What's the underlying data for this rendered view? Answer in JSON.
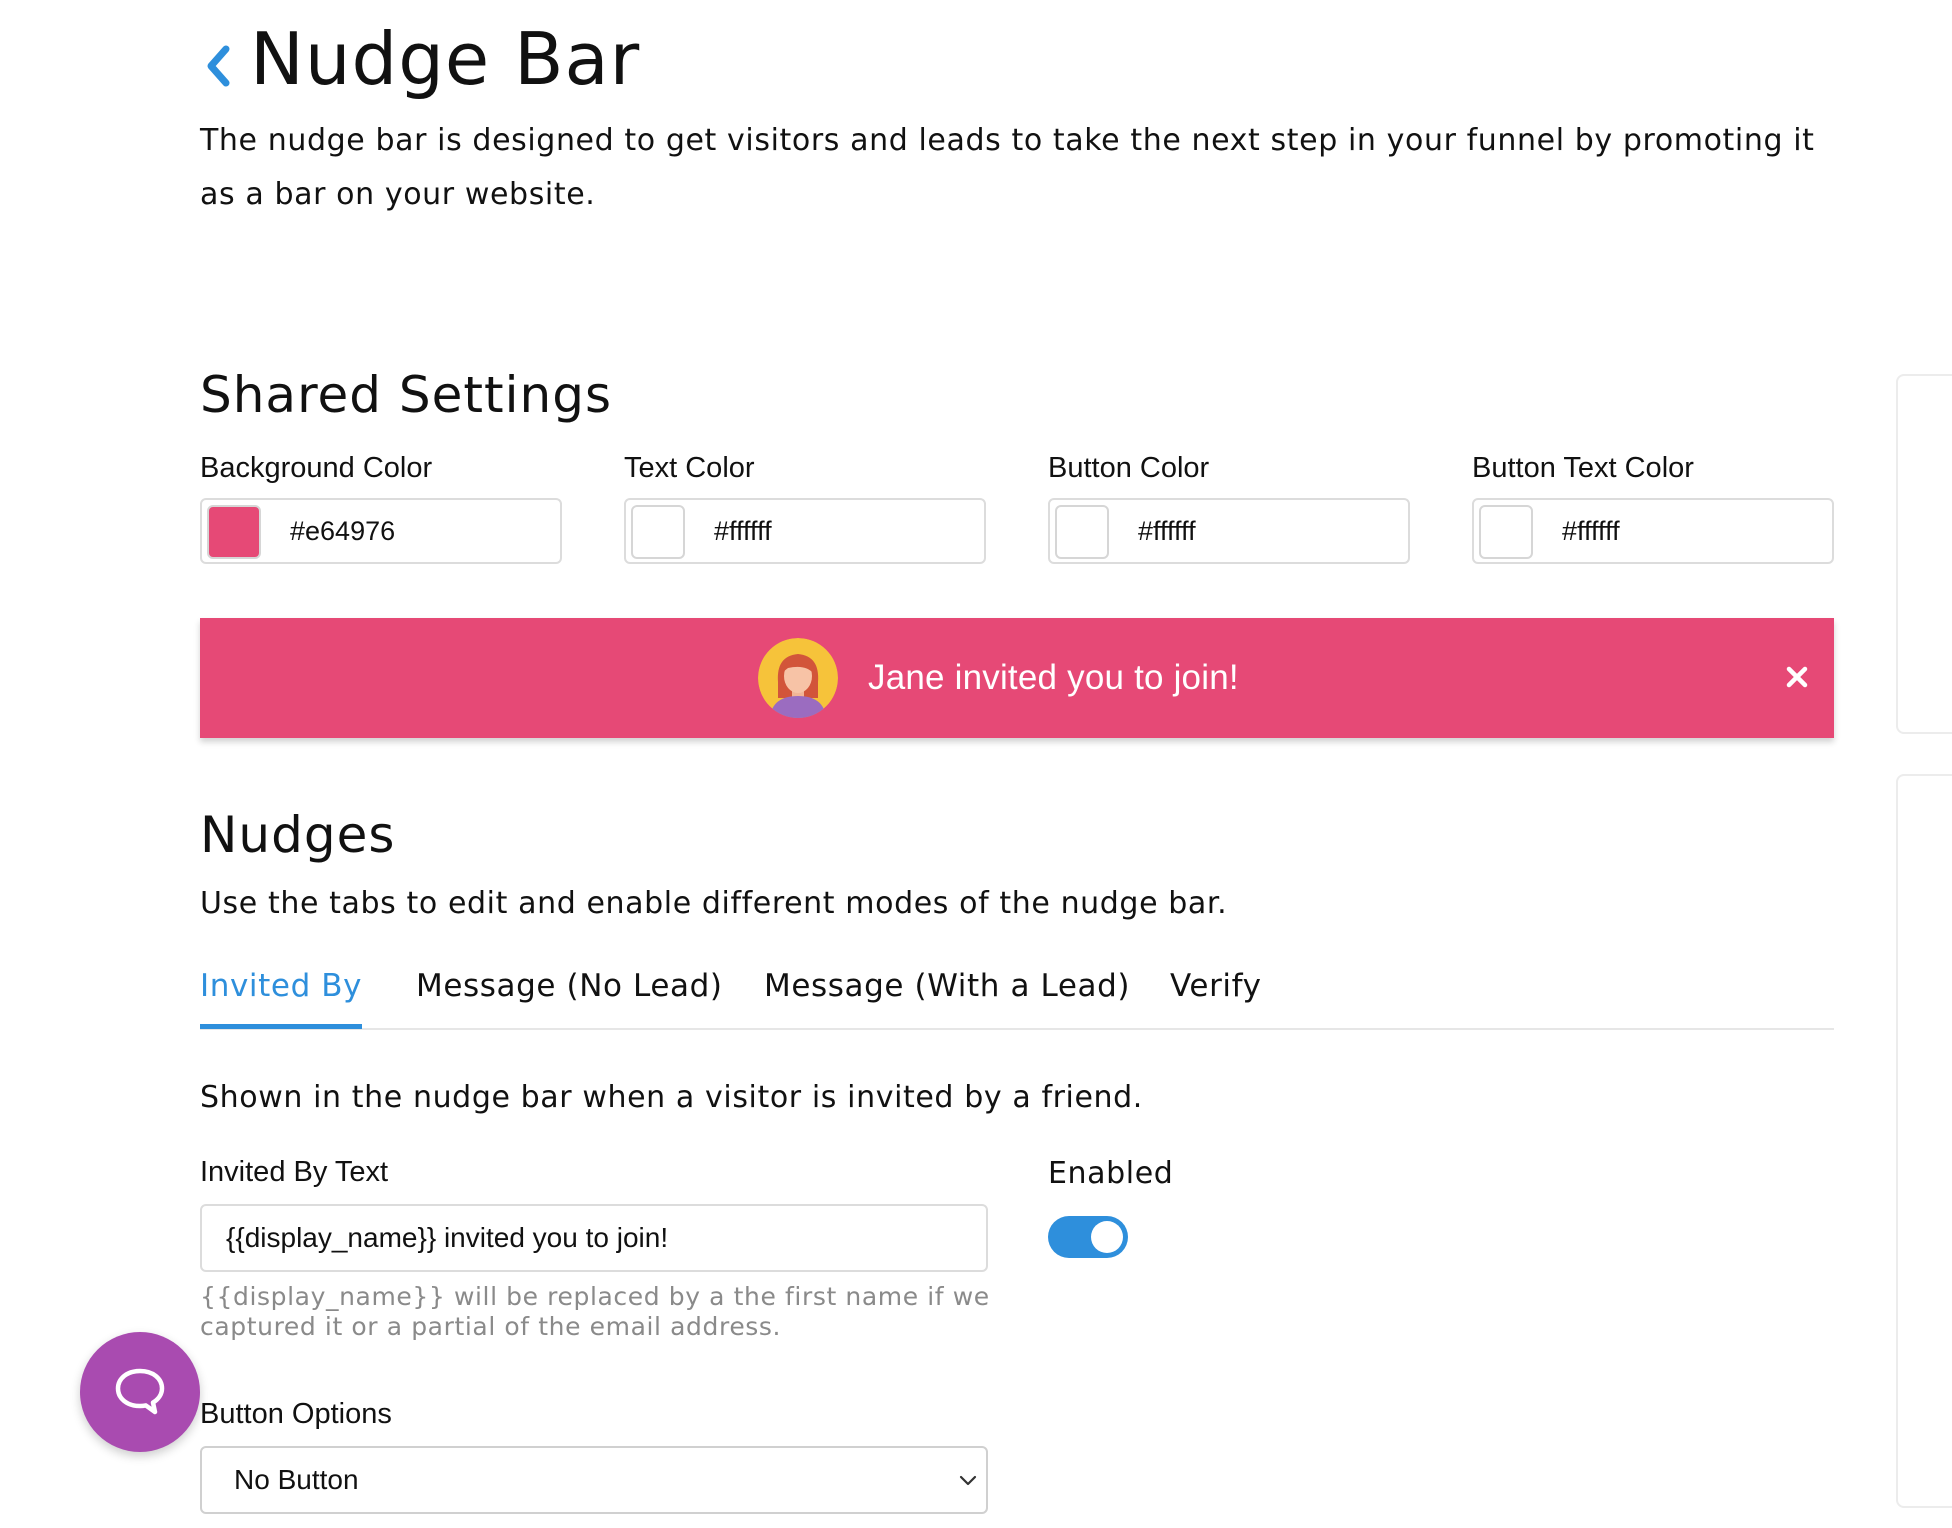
{
  "header": {
    "title": "Nudge Bar",
    "description": "The nudge bar is designed to get visitors and leads to take the next step in your funnel by promoting it as a bar on your website."
  },
  "shared_settings": {
    "title": "Shared Settings",
    "fields": [
      {
        "label": "Background Color",
        "value": "#e64976",
        "swatch": "#e64976"
      },
      {
        "label": "Text Color",
        "value": "#ffffff",
        "swatch": "#ffffff"
      },
      {
        "label": "Button Color",
        "value": "#ffffff",
        "swatch": "#ffffff"
      },
      {
        "label": "Button Text Color",
        "value": "#ffffff",
        "swatch": "#ffffff"
      }
    ]
  },
  "preview": {
    "text": "Jane invited you to join!",
    "background": "#e64976",
    "text_color": "#ffffff"
  },
  "nudges": {
    "title": "Nudges",
    "description": "Use the tabs to edit and enable different modes of the nudge bar.",
    "tabs": [
      {
        "label": "Invited By",
        "active": true
      },
      {
        "label": "Message (No Lead)",
        "active": false
      },
      {
        "label": "Message (With a Lead)",
        "active": false
      },
      {
        "label": "Verify",
        "active": false
      }
    ]
  },
  "invited_by": {
    "description": "Shown in the nudge bar when a visitor is invited by a friend.",
    "text_label": "Invited By Text",
    "text_value": "{{display_name}} invited you to join!",
    "help_line1": "{{display_name}} will be replaced by a the first name if we",
    "help_line2": "captured it or a partial of the email address.",
    "enabled_label": "Enabled",
    "enabled": true,
    "button_options_label": "Button Options",
    "button_options_value": "No Button"
  },
  "colors": {
    "accent": "#2e8fdc",
    "toggle_on": "#2e8fdc",
    "chat_launcher": "#a94bb0"
  },
  "icons": {
    "back": "chevron-left-icon",
    "close": "close-icon",
    "avatar": "avatar-icon",
    "chat": "chat-bubble-icon",
    "select": "chevron-down-icon"
  }
}
